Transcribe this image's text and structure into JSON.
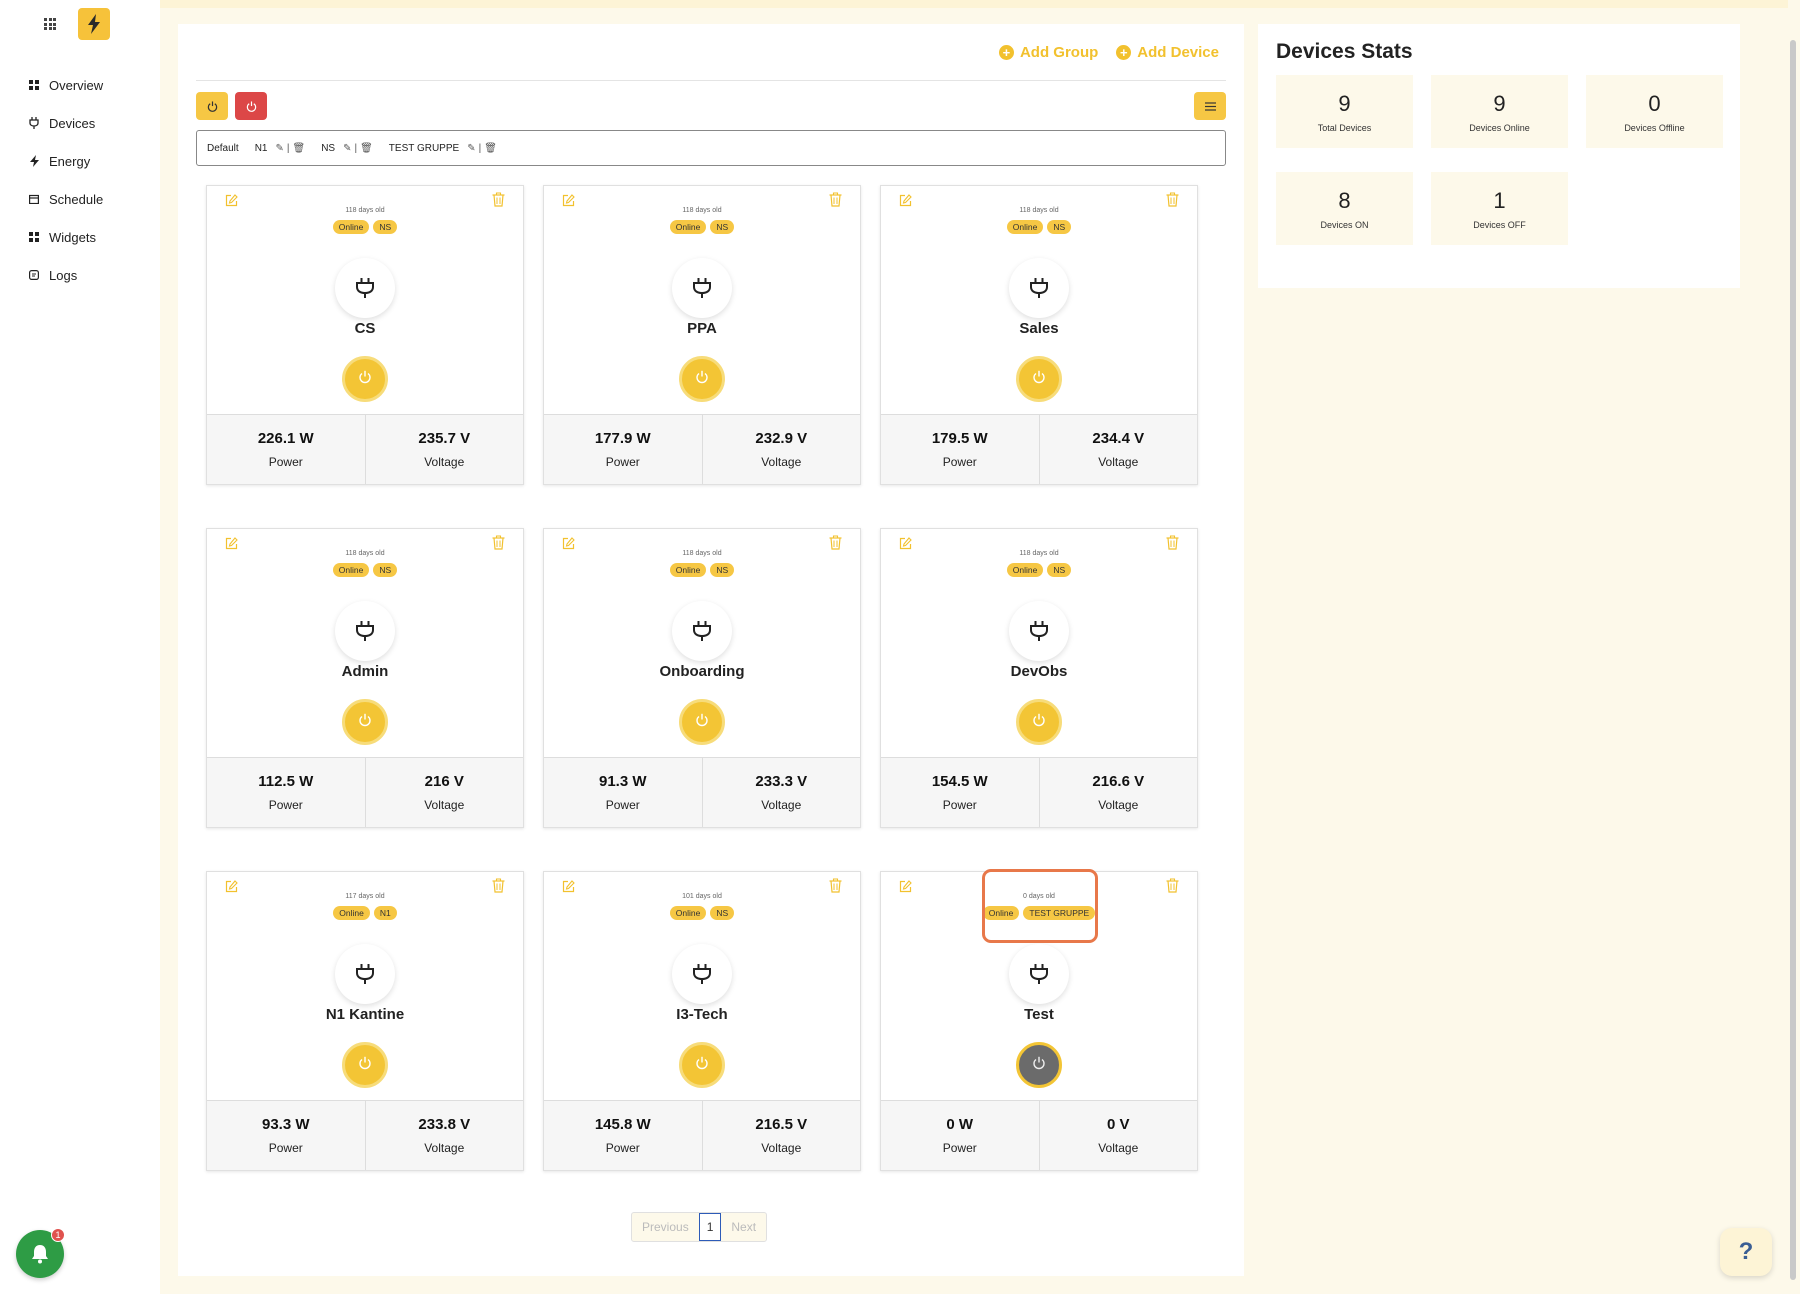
{
  "sidebar": {
    "items": [
      {
        "label": "Overview",
        "icon": "grid-icon"
      },
      {
        "label": "Devices",
        "icon": "plug-icon"
      },
      {
        "label": "Energy",
        "icon": "bolt-icon"
      },
      {
        "label": "Schedule",
        "icon": "calendar-icon"
      },
      {
        "label": "Widgets",
        "icon": "grid-icon"
      },
      {
        "label": "Logs",
        "icon": "log-icon"
      }
    ],
    "notifications_count": "1"
  },
  "toolbar": {
    "add_group": "Add Group",
    "add_device": "Add Device"
  },
  "groups": [
    {
      "label": "Default"
    },
    {
      "label": "N1"
    },
    {
      "label": "NS"
    },
    {
      "label": "TEST GRUPPE"
    }
  ],
  "devices": [
    {
      "age": "118 days old",
      "status": "Online",
      "group": "NS",
      "name": "CS",
      "power": "226.1 W",
      "voltage": "235.7 V",
      "on": true
    },
    {
      "age": "118 days old",
      "status": "Online",
      "group": "NS",
      "name": "PPA",
      "power": "177.9 W",
      "voltage": "232.9 V",
      "on": true
    },
    {
      "age": "118 days old",
      "status": "Online",
      "group": "NS",
      "name": "Sales",
      "power": "179.5 W",
      "voltage": "234.4 V",
      "on": true
    },
    {
      "age": "118 days old",
      "status": "Online",
      "group": "NS",
      "name": "Admin",
      "power": "112.5 W",
      "voltage": "216 V",
      "on": true
    },
    {
      "age": "118 days old",
      "status": "Online",
      "group": "NS",
      "name": "Onboarding",
      "power": "91.3 W",
      "voltage": "233.3 V",
      "on": true
    },
    {
      "age": "118 days old",
      "status": "Online",
      "group": "NS",
      "name": "DevObs",
      "power": "154.5 W",
      "voltage": "216.6 V",
      "on": true
    },
    {
      "age": "117 days old",
      "status": "Online",
      "group": "N1",
      "name": "N1 Kantine",
      "power": "93.3 W",
      "voltage": "233.8 V",
      "on": true
    },
    {
      "age": "101 days old",
      "status": "Online",
      "group": "NS",
      "name": "I3-Tech",
      "power": "145.8 W",
      "voltage": "216.5 V",
      "on": true
    },
    {
      "age": "0 days old",
      "status": "Online",
      "group": "TEST GRUPPE",
      "name": "Test",
      "power": "0 W",
      "voltage": "0 V",
      "on": false
    }
  ],
  "labels": {
    "power": "Power",
    "voltage": "Voltage"
  },
  "pagination": {
    "previous": "Previous",
    "page": "1",
    "next": "Next"
  },
  "stats": {
    "title": "Devices Stats",
    "items": [
      {
        "value": "9",
        "label": "Total Devices"
      },
      {
        "value": "9",
        "label": "Devices Online"
      },
      {
        "value": "0",
        "label": "Devices Offline"
      },
      {
        "value": "8",
        "label": "Devices ON"
      },
      {
        "value": "1",
        "label": "Devices OFF"
      }
    ]
  },
  "colors": {
    "accent": "#f6c744",
    "danger": "#dc4747",
    "off_button": "#6b6b6b",
    "highlight": "#e8784a"
  }
}
